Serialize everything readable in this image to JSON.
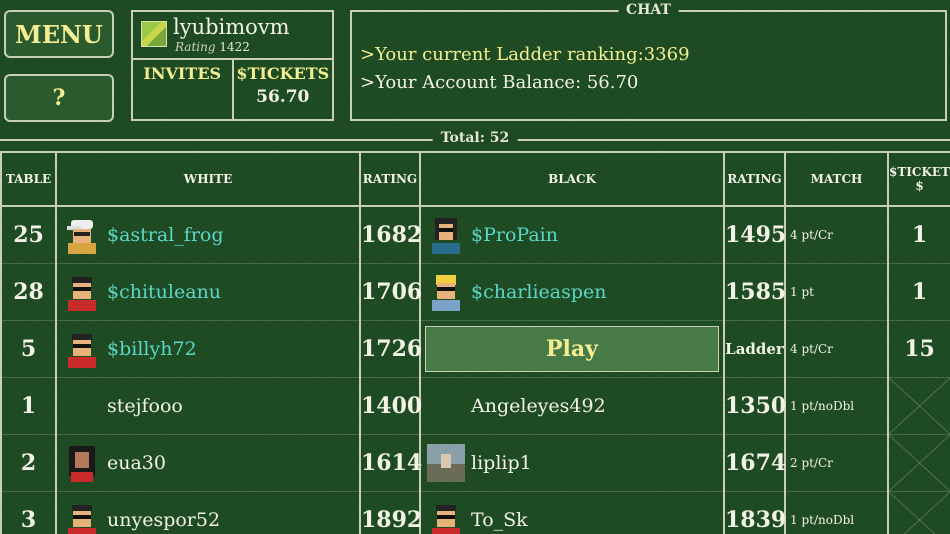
{
  "menu_label": "MENU",
  "help_label": "?",
  "profile": {
    "username": "lyubimovm",
    "rating_label": "Rating",
    "rating_value": "1422",
    "invites_label": "INVITES",
    "tickets_label": "$TICKETS",
    "tickets_value": "56.70"
  },
  "chat": {
    "title": "CHAT",
    "line1": ">Your current Ladder ranking:3369",
    "line2": ">Your Account Balance: 56.70"
  },
  "total_text": "Total:",
  "total_value": "52",
  "columns": {
    "table": "TABLE",
    "white": "WHITE",
    "rating1": "RATING",
    "black": "BLACK",
    "rating2": "RATING",
    "match": "MATCH",
    "tickets": "$TICKET $"
  },
  "rows": [
    {
      "table": "25",
      "white": "$astral_frog",
      "white_rating": "1682",
      "black": "$ProPain",
      "black_rating": "1495",
      "match": "4 pt/Cr",
      "tickets": "1"
    },
    {
      "table": "28",
      "white": "$chituleanu",
      "white_rating": "1706",
      "black": "$charlieaspen",
      "black_rating": "1585",
      "match": "1 pt",
      "tickets": "1"
    },
    {
      "table": "5",
      "white": "$billyh72",
      "white_rating": "1726",
      "black": "Play",
      "black_rating": "Ladder",
      "match": "4 pt/Cr",
      "tickets": "15"
    },
    {
      "table": "1",
      "white": "stejfooo",
      "white_rating": "1400",
      "black": "Angeleyes492",
      "black_rating": "1350",
      "match": "1 pt/noDbl",
      "tickets": ""
    },
    {
      "table": "2",
      "white": "eua30",
      "white_rating": "1614",
      "black": "liplip1",
      "black_rating": "1674",
      "match": "2 pt/Cr",
      "tickets": ""
    },
    {
      "table": "3",
      "white": "unyespor52",
      "white_rating": "1892",
      "black": "To_Sk",
      "black_rating": "1839",
      "match": "1 pt/noDbl",
      "tickets": ""
    }
  ]
}
